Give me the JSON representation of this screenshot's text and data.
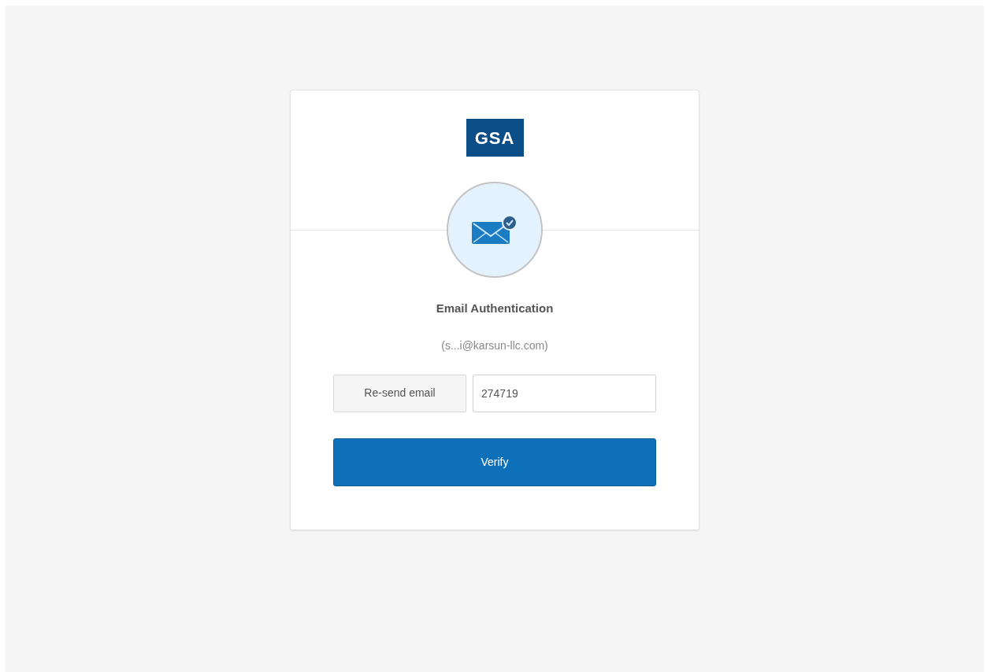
{
  "logo": {
    "text": "GSA"
  },
  "title": "Email Authentication",
  "email": "(s...i@karsun-llc.com)",
  "resend_button": {
    "label": "Re-send email"
  },
  "code_field": {
    "value": "274719"
  },
  "verify_button": {
    "label": "Verify"
  }
}
